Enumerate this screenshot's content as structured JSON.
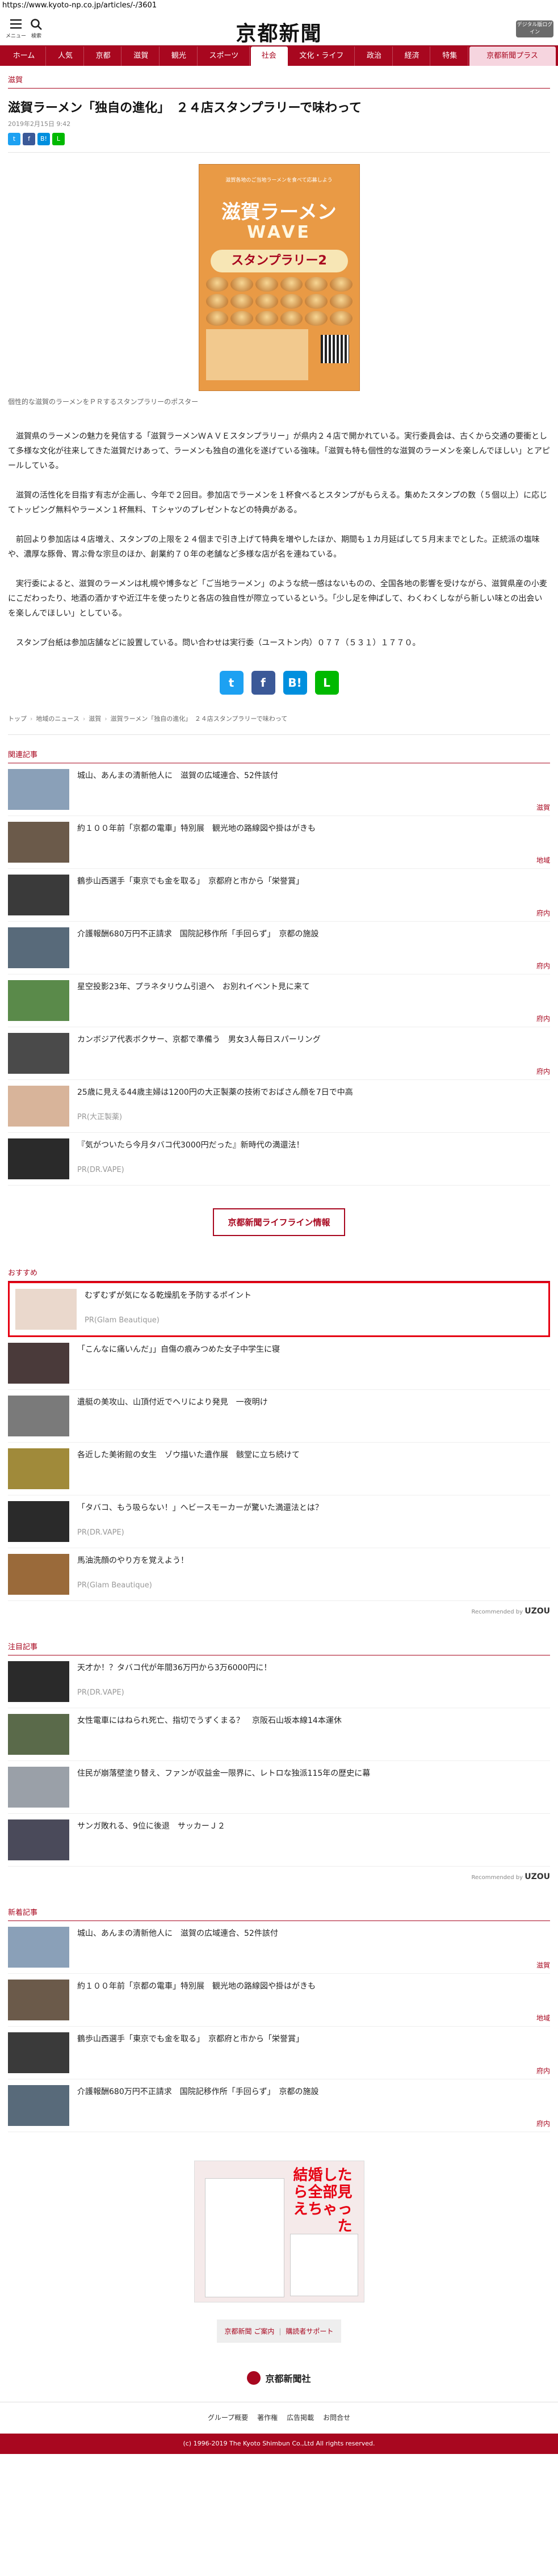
{
  "url": "https://www.kyoto-np.co.jp/articles/-/3601",
  "header": {
    "menu_label": "メニュー",
    "search_label": "検索",
    "logo": "京都新聞",
    "digital_label": "デジタル版ログイン"
  },
  "nav": [
    "ホーム",
    "人気",
    "京都",
    "滋賀",
    "観光",
    "スポーツ",
    "社会",
    "文化・ライフ",
    "政治",
    "経済",
    "特集",
    "京都新聞プラス"
  ],
  "article": {
    "category": "滋賀",
    "title": "滋賀ラーメン「独自の進化」　２４店スタンプラリーで味わって",
    "date": "2019年2月15日 9:42",
    "poster": {
      "top": "滋賀各地のご当地ラーメンを食べて応募しよう",
      "main": "滋賀ラーメン",
      "wave": "WAVE",
      "banner": "スタンプラリー2"
    },
    "caption": "個性的な滋賀のラーメンをＰＲするスタンプラリーのポスター",
    "paragraphs": [
      "滋賀県のラーメンの魅力を発信する「滋賀ラーメンＷＡＶＥスタンプラリー」が県内２４店で開かれている。実行委員会は、古くから交通の要衝として多様な文化が往来してきた滋賀だけあって、ラーメンも独自の進化を遂げている強味。「滋賀も特も個性的な滋賀のラーメンを楽しんでほしい」とアピールしている。",
      "滋賀の活性化を目指す有志が企画し、今年で２回目。参加店でラーメンを１杯食べるとスタンプがもらえる。集めたスタンプの数（５個以上）に応じてトッピング無料やラーメン１杯無料、Ｔシャツのプレゼントなどの特典がある。",
      "前回より参加店は４店増え、スタンプの上限を２４個まで引き上げて特典を増やしたほか、期間も１カ月延ばして５月末までとした。正統派の塩味や、濃厚な豚骨、胃ぶ骨な宗旦のほか、創業約７０年の老舗など多様な店が名を連ねている。",
      "実行委によると、滋賀のラーメンは札幌や博多など「ご当地ラーメン」のような統一感はないものの、全国各地の影響を受けながら、滋賀県産の小麦にこだわったり、地酒の酒かすや近江牛を使ったりと各店の独自性が際立っているという。「少し足を伸ばして、わくわくしながら新しい味との出会いを楽しんでほしい」としている。",
      "スタンプ台紙は参加店舗などに設置している。問い合わせは実行委（ユーストン内）０７７（５３１）１７７０。"
    ],
    "breadcrumb": [
      "トップ",
      "地域のニュース",
      "滋賀",
      "滋賀ラーメン「独自の進化」　２４店スタンプラリーで味わって"
    ]
  },
  "sections": {
    "related": {
      "title": "関連記事",
      "items": [
        {
          "text": "城山、あんまの清新他人に　滋賀の広域連合、52件該付",
          "tag": "滋賀",
          "thumb": "#8aa0b8"
        },
        {
          "text": "約１００年前「京都の電車」特別展　観光地の路線図や掛はがきも",
          "tag": "地域",
          "thumb": "#6b5a4a"
        },
        {
          "text": "鶴歩山西選手「東京でも金を取る」　京都府と市から「栄誉賞」",
          "tag": "府内",
          "thumb": "#3a3a3a"
        },
        {
          "text": "介護報酬680万円不正請求　国院記移作所「手回らず」　京都の施設",
          "tag": "府内",
          "thumb": "#586a7a"
        },
        {
          "text": "星空投影23年、プラネタリウム引退へ　お別れイベント見に来て",
          "tag": "府内",
          "thumb": "#5a8a4a"
        },
        {
          "text": "カンボジア代表ボクサー、京都で準備う　男女3人毎日スパーリング",
          "tag": "府内",
          "thumb": "#4a4a4a"
        },
        {
          "text": "25歳に見える44歳主婦は1200円の大正製薬の技術でおばさん顔を7日で中高",
          "pr": "PR(大正製薬)",
          "thumb": "#d8b49a"
        },
        {
          "text": "『気がついたら今月タバコ代3000円だった』新時代の満還法！",
          "pr": "PR(DR.VAPE)",
          "thumb": "#2a2a2a"
        }
      ]
    },
    "lifeline": "京都新聞ライフライン情報",
    "recommend": {
      "title": "おすすめ",
      "items": [
        {
          "text": "むずむずが気になる乾燥肌を予防するポイント",
          "pr": "PR(Glam Beautique)",
          "thumb": "#ead8cc",
          "highlight": true
        },
        {
          "text": "「こんなに痛いんだ」」自傷の痕みつめた女子中学生に寝",
          "thumb": "#4a3a3a"
        },
        {
          "text": "遺艇の美攻山、山頂付近でヘリにより発見　一夜明け",
          "thumb": "#7a7a7a"
        },
        {
          "text": "各近した美術館の女生　ゾウ描いた遺作展　骸堂に立ち続けて",
          "thumb": "#a08a3a"
        },
        {
          "text": "「タバコ、もう吸らない！」ヘビースモーカーが驚いた満還法とは？",
          "pr": "PR(DR.VAPE)",
          "thumb": "#2a2a2a"
        },
        {
          "text": "馬油洗顔のやり方を覚えよう！",
          "pr": "PR(Glam Beautique)",
          "thumb": "#9a6a3a"
        }
      ],
      "powered": "Recommended by",
      "powered_brand": "UZOU"
    },
    "attention": {
      "title": "注目記事",
      "items": [
        {
          "text": "天才か！？タバコ代が年間36万円から3万6000円に！",
          "pr": "PR(DR.VAPE)",
          "thumb": "#2a2a2a"
        },
        {
          "text": "女性電車にはねられ死亡、指切でうずくまる？　京阪石山坂本線14本運休",
          "thumb": "#5a6a4a"
        },
        {
          "text": "住民が崩落壁塗り替え、ファンが収益金一限界に、レトロな独派115年の歴史に幕",
          "thumb": "#9aa0a8"
        },
        {
          "text": "サンガ敗れる、9位に後退　サッカーＪ２",
          "thumb": "#4a4a5a"
        }
      ],
      "powered": "Recommended by",
      "powered_brand": "UZOU"
    },
    "newest": {
      "title": "新着記事",
      "items": [
        {
          "text": "城山、あんまの清新他人に　滋賀の広域連合、52件該付",
          "tag": "滋賀",
          "thumb": "#8aa0b8"
        },
        {
          "text": "約１００年前「京都の電車」特別展　観光地の路線図や掛はがきも",
          "tag": "地域",
          "thumb": "#6b5a4a"
        },
        {
          "text": "鶴歩山西選手「東京でも金を取る」　京都府と市から「栄誉賞」",
          "tag": "府内",
          "thumb": "#3a3a3a"
        },
        {
          "text": "介護報酬680万円不正請求　国院記移作所「手回らず」　京都の施設",
          "tag": "府内",
          "thumb": "#586a7a"
        }
      ]
    }
  },
  "ad": {
    "headline": "結婚したら全部見えちゃった",
    "colors": {
      "accent": "#e60012"
    }
  },
  "footer": {
    "links": [
      "京都新聞 ご案内",
      "購読者サポート"
    ],
    "logo": "京都新聞社",
    "nav": [
      "グループ概要",
      "著作権",
      "広告掲載",
      "お問合せ"
    ],
    "copyright": "(c) 1996-2019 The Kyoto Shimbun Co.,Ltd All rights reserved."
  },
  "colors": {
    "brand": "#a8071f",
    "twitter": "#1da1f2",
    "facebook": "#3b5998",
    "hatena": "#008fde",
    "line": "#00b900"
  }
}
